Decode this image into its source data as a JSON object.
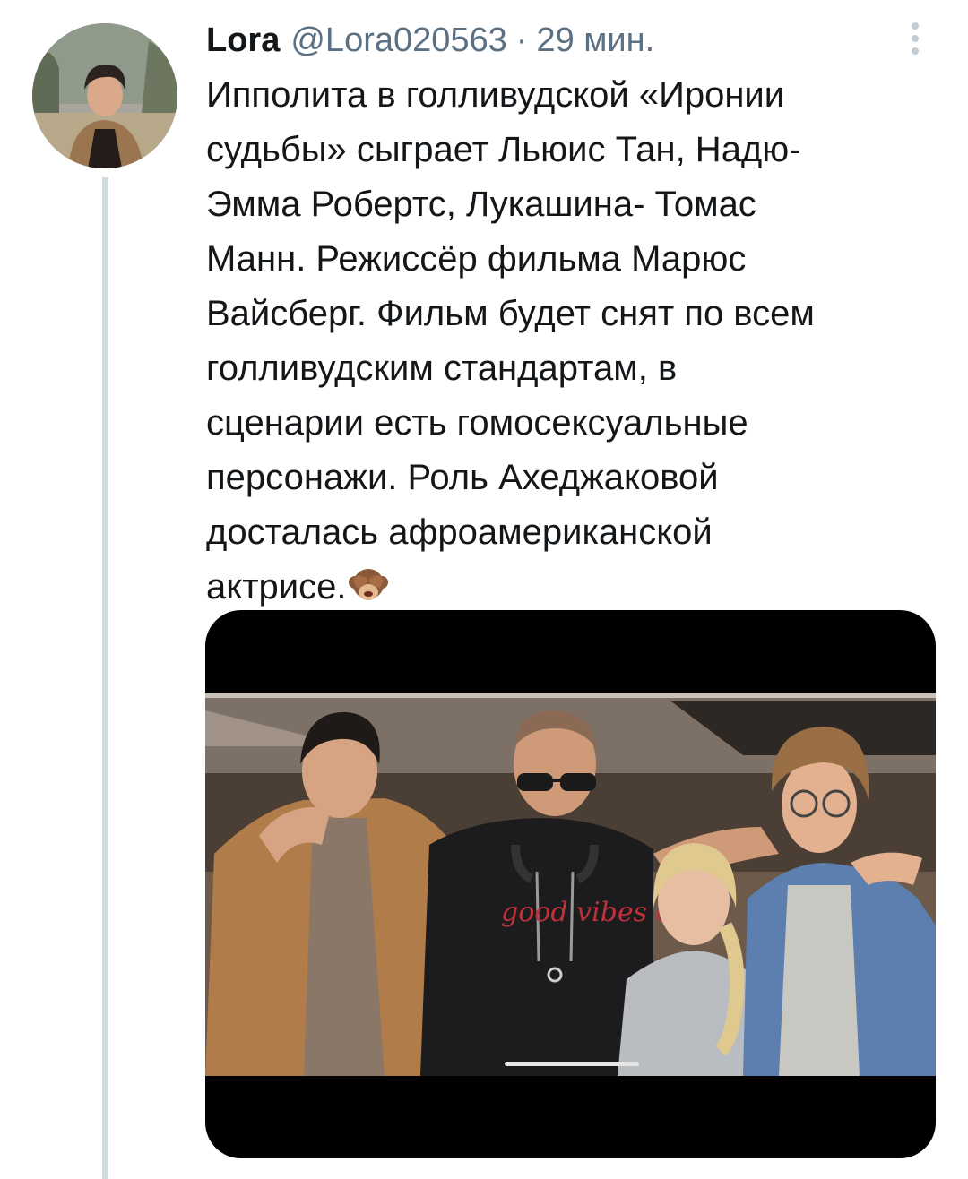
{
  "tweet": {
    "display_name": "Lora",
    "handle": "@Lora020563",
    "separator": "·",
    "timestamp": "29 мин.",
    "text_lines": [
      "Ипполита в голливудской «Иронии",
      "судьбы» сыграет Льюис Тан, Надю-",
      "Эмма Робертс, Лукашина- Томас",
      "Манн. Режиссёр фильма Марюс",
      "Вайсберг. Фильм будет снят по всем",
      "голливудским стандартам, в",
      "сценарии есть гомосексуальные",
      "персонажи. Роль Ахеджаковой",
      "досталась афроамериканской",
      "актрисе."
    ],
    "emoji": "see-no-evil-monkey",
    "shirt_print": "good vibes only"
  },
  "icons": {
    "more": "vertical-ellipsis-icon"
  },
  "colors": {
    "text_primary": "#14171a",
    "text_secondary": "#5b7083",
    "thread_line": "#cfd9de",
    "media_background": "#000000"
  }
}
